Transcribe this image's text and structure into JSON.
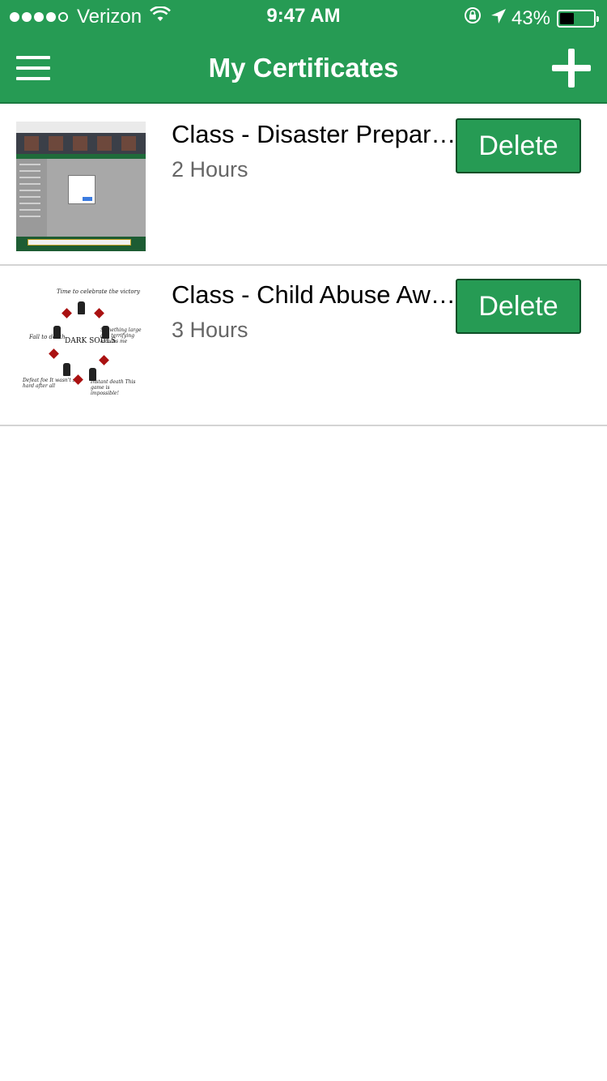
{
  "status_bar": {
    "carrier": "Verizon",
    "time": "9:47 AM",
    "battery_percent": "43%",
    "battery_level": 0.43,
    "signal_strength": 4,
    "signal_max": 5
  },
  "nav": {
    "title": "My Certificates",
    "menu_icon": "hamburger-menu-icon",
    "add_icon": "plus-icon"
  },
  "colors": {
    "primary_green": "#269b54",
    "button_border": "#0e4f27",
    "divider": "#d4d4d4",
    "subtitle_gray": "#666666"
  },
  "certificates": [
    {
      "title": "Class - Disaster Preparedness",
      "hours": "2 Hours",
      "delete_label": "Delete"
    },
    {
      "title": "Class - Child Abuse Awareness",
      "hours": "3 Hours",
      "delete_label": "Delete",
      "thumbnail_text": {
        "center": "DARK SOULS",
        "top": "Time to celebrate the victory",
        "right": "Something large and terrifying attacks me",
        "bottom_right": "Instant death This game is impossible!",
        "bottom_left": "Defeat foe It wasn't so hard after all",
        "left": "Fall to death"
      }
    }
  ]
}
